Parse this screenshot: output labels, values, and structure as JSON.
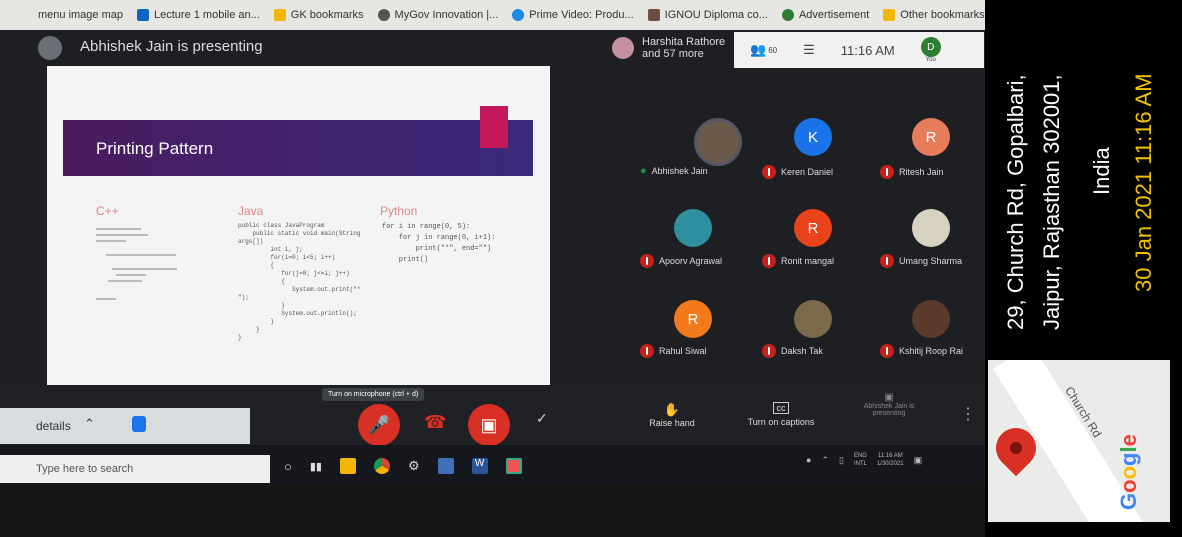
{
  "bookmarks": [
    {
      "label": "menu image map",
      "color": "#999"
    },
    {
      "label": "Lecture 1 mobile an...",
      "color": "#0a66c2"
    },
    {
      "label": "GK bookmarks",
      "color": "#f2b705"
    },
    {
      "label": "MyGov Innovation |...",
      "color": "#555"
    },
    {
      "label": "Prime Video: Produ...",
      "color": "#1e88e5"
    },
    {
      "label": "IGNOU Diploma co...",
      "color": "#6d4c41"
    },
    {
      "label": "Advertisement",
      "color": "#2e7d32"
    },
    {
      "label": "Other bookmarks",
      "color": "#f2b705"
    }
  ],
  "meet": {
    "presenter_text": "Abhishek Jain is presenting",
    "people_line1": "Harshita Rathore",
    "people_line2": "and 57 more",
    "people_count": "60",
    "time": "11:16 AM",
    "user_initial": "D",
    "user_label": "You"
  },
  "slide": {
    "title": "Printing Pattern",
    "col1_heading": "C++",
    "col2_heading": "Java",
    "col3_heading": "Python",
    "java_code": "public class JavaProgram\n    public static void main(String\nargs[])\n         int i, j;\n         for(i=0; i<5; i++)\n         {\n            for(j=0; j<=i; j++)\n            {\n               System.out.print(\"*\n\");\n            }\n            System.out.println();\n         }\n     }\n}",
    "python_code": "for i in range(0, 5):\n    for j in range(0, i+1):\n        print(\"*\", end=\"\")\n    print()"
  },
  "participants": [
    {
      "name": "Abhishek Jain",
      "initial": "",
      "color": "#6a5a4a",
      "speaking": true
    },
    {
      "name": "Keren Daniel",
      "initial": "K",
      "color": "#1a73e8",
      "speaking": false
    },
    {
      "name": "Ritesh Jain",
      "initial": "R",
      "color": "#e67c5a",
      "speaking": false
    },
    {
      "name": "Apoorv Agrawal",
      "initial": "",
      "color": "#2f8fa0",
      "speaking": false
    },
    {
      "name": "Ronit mangal",
      "initial": "R",
      "color": "#e8431a",
      "speaking": false
    },
    {
      "name": "Umang Sharma",
      "initial": "",
      "color": "#d8d2c0",
      "speaking": false
    },
    {
      "name": "Rahul Siwal",
      "initial": "R",
      "color": "#f27a1a",
      "speaking": false
    },
    {
      "name": "Daksh Tak",
      "initial": "",
      "color": "#7a6a4a",
      "speaking": false
    },
    {
      "name": "Kshitij Roop Rai",
      "initial": "",
      "color": "#5a3a2a",
      "speaking": false
    }
  ],
  "controls": {
    "tooltip": "Turn on microphone (ctrl + d)",
    "raise_hand": "Raise hand",
    "captions": "Turn on captions",
    "presenting": "Abhishek Jain is presenting",
    "details": "details"
  },
  "taskbar": {
    "search_placeholder": "Type here to search",
    "lang": "ENG",
    "lang2": "INTL",
    "tray_time": "11:16 AM",
    "tray_date": "1/30/2021"
  },
  "overlay": {
    "address_line1": "29, Church Rd, Gopalbari,",
    "address_line2": "Jaipur, Rajasthan 302001,",
    "address_line3": "India",
    "timestamp": "30 Jan 2021 11:16 AM",
    "map_road": "Church Rd",
    "map_brand": "Google"
  }
}
